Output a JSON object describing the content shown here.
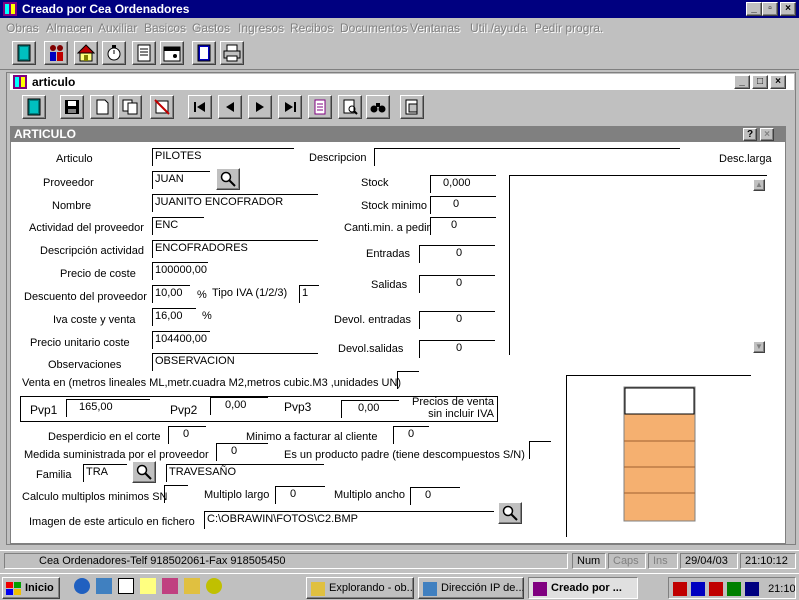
{
  "window": {
    "title": "Creado por Cea Ordenadores"
  },
  "menu": [
    "Obras",
    "Almacen",
    "Auxiliar",
    "Basicos",
    "Gastos",
    "Ingresos",
    "Recibos",
    "Documentos",
    "Ventanas",
    "Util./ayuda",
    "Pedir progra."
  ],
  "main_toolbar_icons": [
    "exit-door-icon",
    "people-icon",
    "house-icon",
    "stopwatch-icon",
    "document-icon",
    "calendar-icon",
    "book-icon",
    "printer-icon"
  ],
  "child": {
    "title": "articulo",
    "toolbar_icons": [
      "exit-door-icon",
      "save-icon",
      "new-doc-icon",
      "copy-icon",
      "delete-icon",
      "first-record-icon",
      "prev-record-icon",
      "next-record-icon",
      "last-record-icon",
      "list-icon",
      "preview-icon",
      "binoculars-icon",
      "report-icon"
    ]
  },
  "form": {
    "header": "ARTICULO",
    "help": "?",
    "close": "×",
    "labels": {
      "articulo": "Articulo",
      "descripcion": "Descripcion",
      "desc_larga": "Desc.larga",
      "proveedor": "Proveedor",
      "stock": "Stock",
      "nombre": "Nombre",
      "stock_minimo": "Stock minimo",
      "actividad": "Actividad del proveedor",
      "canti_min": "Canti.min. a pedir",
      "desc_actividad": "Descripción actividad",
      "entradas": "Entradas",
      "precio_coste": "Precio de coste",
      "salidas": "Salidas",
      "descuento": "Descuento del proveedor",
      "pct": "%",
      "tipo_iva": "Tipo IVA (1/2/3)",
      "iva_coste": "Iva coste y venta",
      "devol_entradas": "Devol. entradas",
      "precio_unitario": "Precio unitario coste",
      "devol_salidas": "Devol.salidas",
      "observaciones": "Observaciones",
      "venta_en": "Venta en (metros lineales ML,metr.cuadra M2,metros cubic.M3 ,unidades UN)",
      "pvp1": "Pvp1",
      "pvp2": "Pvp2",
      "pvp3": "Pvp3",
      "precios_venta": "Precios de venta\nsin incluir IVA",
      "desperdicio": "Desperdicio en el corte",
      "minimo_facturar": "Minimo a facturar al cliente",
      "medida": "Medida suministrada por el proveedor",
      "producto_padre": "Es un producto padre (tiene descompuestos S/N)",
      "familia": "Familia",
      "calculo": "Calculo multiplos minimos SN",
      "multiplo_largo": "Multiplo largo",
      "multiplo_ancho": "Multiplo ancho",
      "imagen": "Imagen de este articulo en fichero"
    },
    "values": {
      "articulo": "PILOTES",
      "descripcion": "",
      "proveedor": "JUAN",
      "stock": "0,000",
      "nombre": "JUANITO ENCOFRADOR",
      "stock_minimo": "0",
      "actividad": "ENC",
      "canti_min": "0",
      "desc_actividad": "ENCOFRADORES",
      "entradas": "0",
      "precio_coste": "100000,00",
      "salidas": "0",
      "descuento": "10,00",
      "tipo_iva": "1",
      "iva": "16,00",
      "devol_entradas": "0",
      "precio_unitario": "104400,00",
      "devol_salidas": "0",
      "observaciones": "OBSERVACION",
      "venta_en": "",
      "pvp1": "165,00",
      "pvp2": "0,00",
      "pvp3": "0,00",
      "desperdicio": "0",
      "minimo_facturar": "0",
      "medida": "0",
      "producto_padre": "",
      "familia_code": "TRA",
      "familia_name": "TRAVESAÑO",
      "calculo": "",
      "multiplo_largo": "0",
      "multiplo_ancho": "0",
      "imagen": "C:\\OBRAWIN\\FOTOS\\C2.BMP"
    }
  },
  "status": {
    "company": "Cea Ordenadores-Telf 918502061-Fax 918505450",
    "num": "Num",
    "caps": "Caps",
    "ins": "Ins",
    "date": "29/04/03",
    "time": "21:10:12"
  },
  "taskbar": {
    "start": "Inicio",
    "tasks": [
      "Explorando - ob...",
      "Dirección IP de...",
      "Creado por ..."
    ],
    "clock": "21:10"
  }
}
